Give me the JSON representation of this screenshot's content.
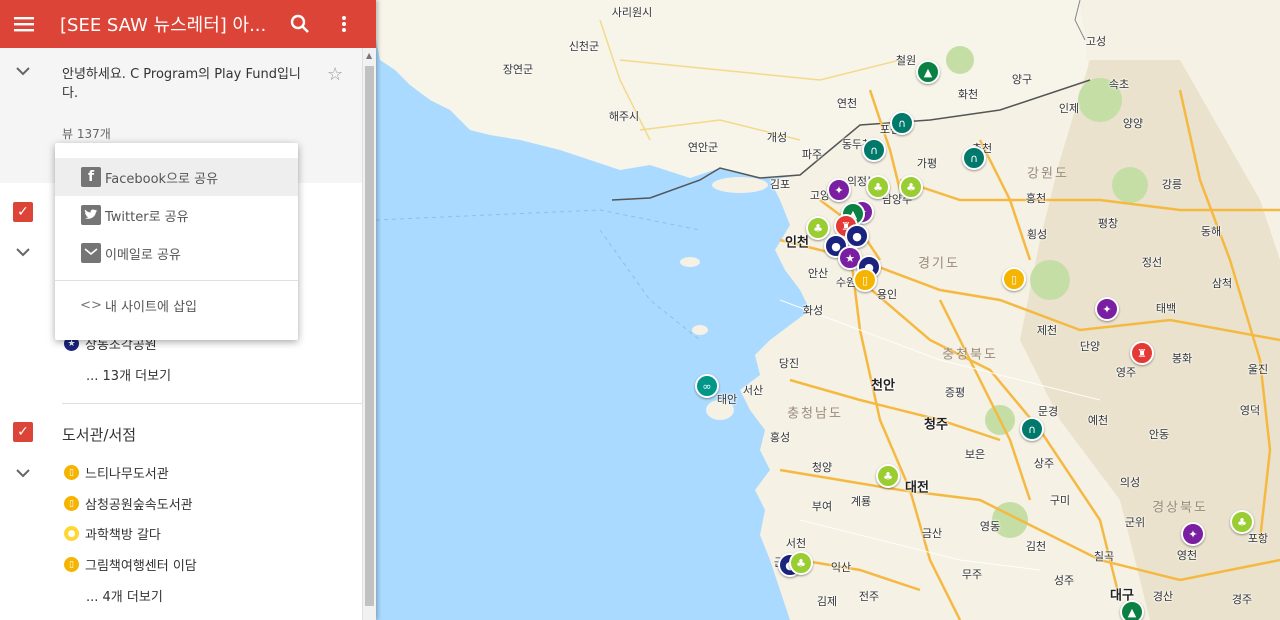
{
  "header": {
    "title": "[SEE SAW 뉴스레터] 아...",
    "menu_icon": "menu-icon",
    "search_icon": "search-icon",
    "more_icon": "more-vert-icon",
    "color": "#db4437"
  },
  "info": {
    "description": "안녕하세요. C Program의 Play Fund입니다.",
    "views": "뷰 137개"
  },
  "share_menu": {
    "facebook": "Facebook으로 공유",
    "twitter": "Twitter로 공유",
    "email": "이메일로 공유",
    "embed": "내 사이트에 삽입"
  },
  "layer1": {
    "partial_item": "상동조각공원",
    "more": "... 13개 더보기"
  },
  "layer2": {
    "title": "도서관/서점",
    "items": [
      "느티나무도서관",
      "삼청공원숲속도서관",
      "과학책방 갈다",
      "그림책여행센터 이담"
    ],
    "more": "... 4개 더보기"
  },
  "map": {
    "places": {
      "sariwon": "사리원시",
      "sincheon": "신천군",
      "jangyeon": "장연군",
      "haeju": "해주시",
      "yeonan": "연안군",
      "gaeseong": "개성",
      "yeoncheon": "연천",
      "paju": "파주",
      "dongducheon": "동두천",
      "pocheon": "포천",
      "gapyeong": "가평",
      "chuncheon": "춘천",
      "cheorwon": "철원",
      "hwacheon": "화천",
      "yanggu": "양구",
      "inje": "인제",
      "sokcho": "속초",
      "yangyang": "양양",
      "goseong": "고성",
      "gimpo": "김포",
      "goyang": "고양",
      "uijeongbu": "의정부",
      "namyangju": "남양주",
      "hongcheon": "홍천",
      "gangneung": "강릉",
      "incheon": "인천",
      "hoengseong": "횡성",
      "pyeongchang": "평창",
      "donghae": "동해",
      "ansan": "안산",
      "suwon": "수원",
      "yongin": "용인",
      "jeongseon": "정선",
      "samcheok": "삼척",
      "taebaek": "태백",
      "hwaseong": "화성",
      "jecheon": "제천",
      "danyang": "단양",
      "bonghwa": "봉화",
      "uljin": "울진",
      "dangjin": "당진",
      "seosan": "서산",
      "taean": "태안",
      "cheonan": "천안",
      "jeungpyeong": "증평",
      "cheongju": "청주",
      "mungyeong": "문경",
      "yeongju": "영주",
      "yecheon": "예천",
      "andong": "안동",
      "yeongdeok": "영덕",
      "hongseong": "홍성",
      "cheongyang": "청양",
      "boeun": "보은",
      "sangju": "상주",
      "gyeryong": "계룡",
      "daejeon": "대전",
      "buyeo": "부여",
      "yeongdong": "영동",
      "gumi": "구미",
      "gunwi": "군위",
      "uiseong": "의성",
      "pohang": "포항",
      "yeongcheon": "영천",
      "seocheon": "서천",
      "geumsan": "금산",
      "gimcheon": "김천",
      "chilgok": "칠곡",
      "iksan": "익산",
      "muju": "무주",
      "gimje": "김제",
      "jeonju": "전주",
      "seongju": "성주",
      "daegu": "대구",
      "gyeongsan": "경산",
      "gyeongju": "경주",
      "gunsan": "군산"
    },
    "provinces": {
      "gangwon": "강원도",
      "gyeonggi": "경기도",
      "chungbuk": "충청북도",
      "chungnam": "충청남도",
      "gyeongbuk": "경상북도"
    }
  }
}
